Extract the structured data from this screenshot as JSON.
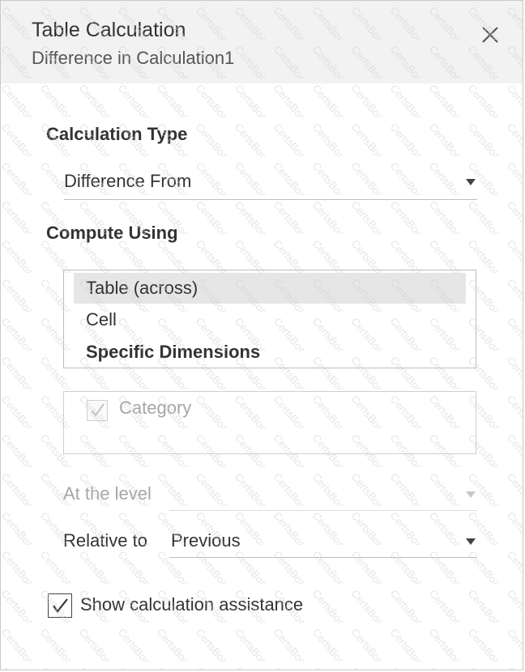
{
  "dialog": {
    "title": "Table Calculation",
    "subtitle": "Difference in Calculation1",
    "close_icon": "close-icon"
  },
  "calculation_type": {
    "label": "Calculation Type",
    "value": "Difference From"
  },
  "compute_using": {
    "label": "Compute Using",
    "options": [
      {
        "label": "Table (across)",
        "selected": true
      },
      {
        "label": "Cell",
        "selected": false
      },
      {
        "label": "Specific Dimensions",
        "selected": false
      }
    ],
    "dimensions": [
      {
        "label": "Category",
        "checked": true,
        "enabled": false
      }
    ]
  },
  "at_the_level": {
    "label": "At the level",
    "value": "",
    "enabled": false
  },
  "relative_to": {
    "label": "Relative to",
    "value": "Previous"
  },
  "assistance": {
    "label": "Show calculation assistance",
    "checked": true
  },
  "watermark": {
    "text": "CertsBoard"
  },
  "colors": {
    "header_bg": "#f2f2f2",
    "selected_bg": "#e6e6e6",
    "disabled_text": "#a6a6a6",
    "text": "#333333"
  }
}
